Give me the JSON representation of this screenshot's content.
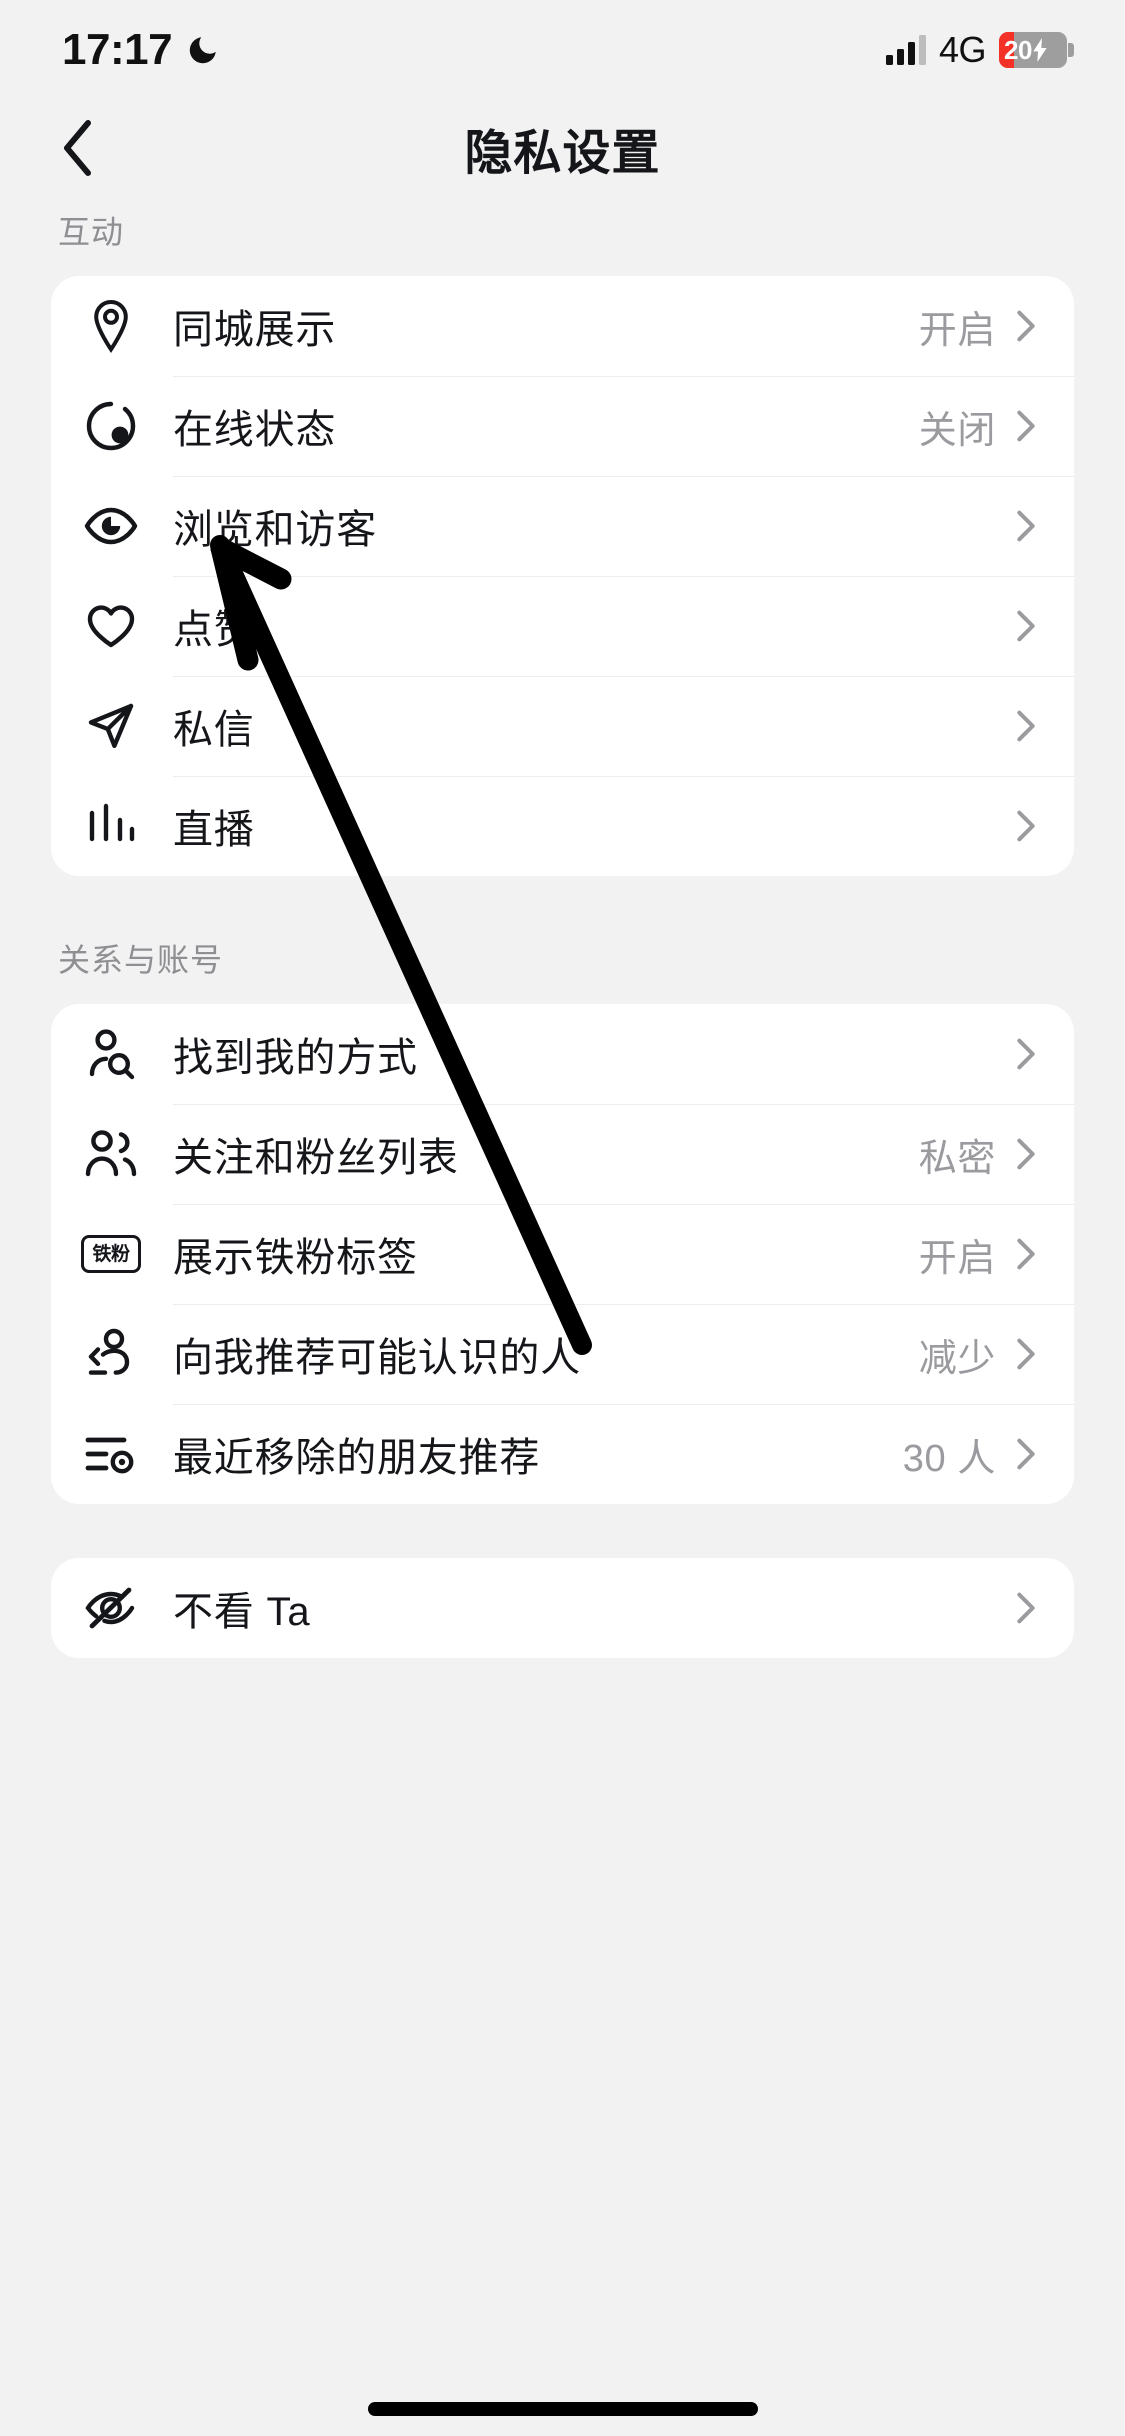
{
  "status_bar": {
    "time": "17:17",
    "moon_icon": "moon-icon",
    "signal_icon": "signal-bars-icon",
    "network": "4G",
    "battery_percent": "20",
    "battery_charging_icon": "lightning-bolt-icon"
  },
  "nav": {
    "back_icon": "chevron-left-icon",
    "title": "隐私设置"
  },
  "sections": [
    {
      "label": "互动",
      "items": [
        {
          "icon": "location-pin-icon",
          "label": "同城展示",
          "value": "开启"
        },
        {
          "icon": "online-status-icon",
          "label": "在线状态",
          "value": "关闭"
        },
        {
          "icon": "eye-icon",
          "label": "浏览和访客",
          "value": ""
        },
        {
          "icon": "heart-icon",
          "label": "点赞",
          "value": ""
        },
        {
          "icon": "paper-plane-icon",
          "label": "私信",
          "value": ""
        },
        {
          "icon": "live-bars-icon",
          "label": "直播",
          "value": ""
        }
      ]
    },
    {
      "label": "关系与账号",
      "items": [
        {
          "icon": "person-search-icon",
          "label": "找到我的方式",
          "value": ""
        },
        {
          "icon": "two-people-icon",
          "label": "关注和粉丝列表",
          "value": "私密"
        },
        {
          "icon": "fan-badge-icon",
          "label": "展示铁粉标签",
          "value": "开启",
          "badge_text": "铁粉"
        },
        {
          "icon": "person-suggest-icon",
          "label": "向我推荐可能认识的人",
          "value": "减少"
        },
        {
          "icon": "list-remove-icon",
          "label": "最近移除的朋友推荐",
          "value": "30 人"
        }
      ]
    },
    {
      "label": "",
      "items": [
        {
          "icon": "eye-off-icon",
          "label": "不看 Ta",
          "value": ""
        }
      ]
    }
  ],
  "annotation": {
    "arrow_icon": "hand-drawn-arrow-annotation"
  },
  "colors": {
    "background": "#f2f2f2",
    "card": "#ffffff",
    "text_primary": "#15161a",
    "text_secondary": "#9a9a9f",
    "section_label": "#8e8e93",
    "divider": "#ededee",
    "battery_low": "#f43127",
    "battery_body": "#9e9e9e"
  }
}
